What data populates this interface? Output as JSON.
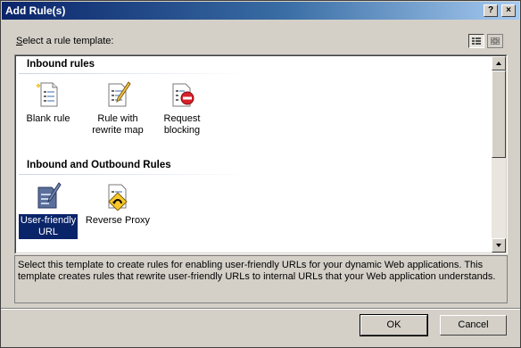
{
  "window": {
    "title": "Add Rule(s)",
    "help_label": "?",
    "close_label": "×"
  },
  "prompt": {
    "accel": "S",
    "rest": "elect a rule template:"
  },
  "view_buttons": [
    {
      "icon": "details-view-icon",
      "active": true
    },
    {
      "icon": "tiles-view-icon",
      "active": false
    }
  ],
  "groups": [
    {
      "header": "Inbound rules",
      "items": [
        {
          "label_lines": [
            "Blank rule"
          ],
          "icon": "blank-rule-icon",
          "selected": false
        },
        {
          "label_lines": [
            "Rule with",
            "rewrite map"
          ],
          "icon": "rewrite-map-icon",
          "selected": false
        },
        {
          "label_lines": [
            "Request",
            "blocking"
          ],
          "icon": "request-blocking-icon",
          "selected": false
        }
      ]
    },
    {
      "header": "Inbound and Outbound Rules",
      "items": [
        {
          "label_lines": [
            "User-friendly",
            "URL"
          ],
          "icon": "user-friendly-url-icon",
          "selected": true
        },
        {
          "label_lines": [
            "Reverse Proxy"
          ],
          "icon": "reverse-proxy-icon",
          "selected": false
        }
      ]
    }
  ],
  "description": "Select this template to create rules for enabling user-friendly URLs for your dynamic Web applications. This template creates rules that rewrite user-friendly URLs to internal URLs that your Web application understands.",
  "buttons": {
    "ok": "OK",
    "cancel": "Cancel"
  },
  "colors": {
    "title_bar": "#0a246a",
    "selection": "#0a246a",
    "dialog_bg": "#d4d0c8"
  }
}
